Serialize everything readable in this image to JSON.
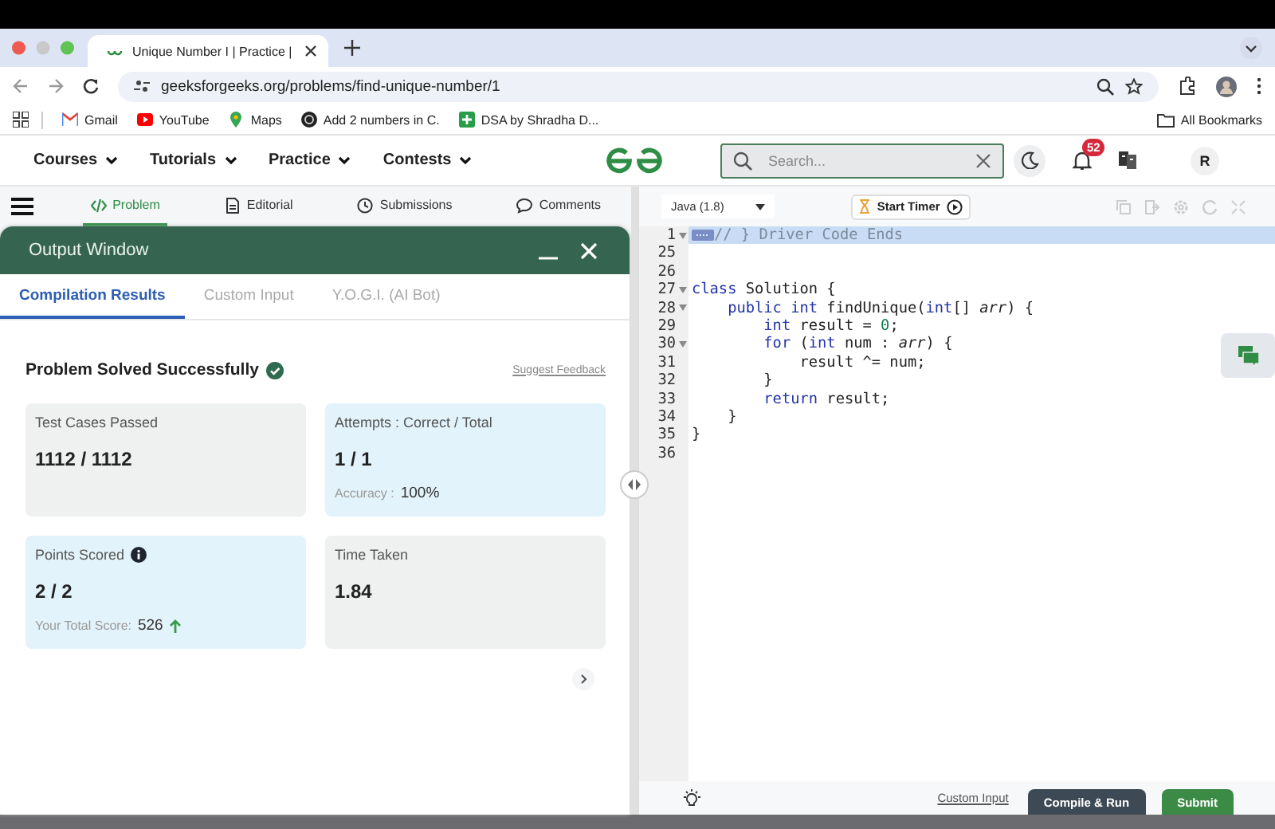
{
  "browser": {
    "tab_title": "Unique Number I | Practice |",
    "url": "geeksforgeeks.org/problems/find-unique-number/1",
    "bookmarks": [
      {
        "kind": "mail",
        "label": "Gmail"
      },
      {
        "kind": "video",
        "label": "YouTube"
      },
      {
        "kind": "pin",
        "label": "Maps"
      },
      {
        "kind": "circle",
        "label": "Add 2 numbers in C."
      },
      {
        "kind": "plus",
        "label": "DSA by Shradha D..."
      }
    ],
    "all_bookmarks": "All Bookmarks"
  },
  "site_nav": {
    "menus": [
      "Courses",
      "Tutorials",
      "Practice",
      "Contests"
    ],
    "search": {
      "placeholder": "Search..."
    },
    "notification_count": "52",
    "avatar": "R"
  },
  "problem_tabs": [
    {
      "kind": "code",
      "label": "Problem",
      "selected": true
    },
    {
      "kind": "doc",
      "label": "Editorial",
      "selected": false
    },
    {
      "kind": "clock",
      "label": "Submissions",
      "selected": false
    },
    {
      "kind": "chat",
      "label": "Comments",
      "selected": false
    }
  ],
  "output_window": {
    "title": "Output Window",
    "tabs": [
      {
        "label": "Compilation Results",
        "selected": true
      },
      {
        "label": "Custom Input",
        "selected": false
      },
      {
        "label": "Y.O.G.I. (AI Bot)",
        "selected": false
      }
    ],
    "status": "Problem Solved Successfully",
    "feedback_link": "Suggest Feedback",
    "cards": [
      {
        "label": "Test Cases Passed",
        "value": "1112 / 1112",
        "highlighted": false,
        "info": false,
        "rising": false
      },
      {
        "label": "Attempts : Correct / Total",
        "value": "1 / 1",
        "note_label": "Accuracy :",
        "note_value": "100%",
        "highlighted": true,
        "info": false,
        "rising": false
      },
      {
        "label": "Points Scored",
        "value": "2 / 2",
        "note_label": "Your Total Score:",
        "note_value": "526",
        "highlighted": true,
        "info": true,
        "rising": true
      },
      {
        "label": "Time Taken",
        "value": "1.84",
        "highlighted": false,
        "info": false,
        "rising": false
      }
    ]
  },
  "editor": {
    "language": "Java (1.8)",
    "timer": "Start Timer",
    "lines": [
      {
        "number": "1",
        "fold": true,
        "highlighted": true,
        "tokens": [
          {
            "kind": "comment",
            "text": "// } Driver Code Ends"
          }
        ]
      },
      {
        "number": "25",
        "fold": false,
        "highlighted": false
      },
      {
        "number": "26",
        "fold": false,
        "highlighted": false
      },
      {
        "number": "27",
        "fold": true,
        "highlighted": false,
        "tokens": [
          {
            "kind": "keyword",
            "text": "class"
          },
          {
            "kind": "plain",
            "text": " Solution {"
          }
        ]
      },
      {
        "number": "28",
        "fold": true,
        "highlighted": false,
        "tokens": [
          {
            "kind": "keyword",
            "text": "    public"
          },
          {
            "kind": "keyword",
            "text": " int"
          },
          {
            "kind": "plain",
            "text": " findUnique("
          },
          {
            "kind": "keyword",
            "text": "int"
          },
          {
            "kind": "plain",
            "text": "[] "
          },
          {
            "kind": "param",
            "text": "arr"
          },
          {
            "kind": "plain",
            "text": ") {"
          }
        ]
      },
      {
        "number": "29",
        "fold": false,
        "highlighted": false,
        "tokens": [
          {
            "kind": "keyword",
            "text": "        int"
          },
          {
            "kind": "plain",
            "text": " result = "
          },
          {
            "kind": "number",
            "text": "0"
          },
          {
            "kind": "plain",
            "text": ";"
          }
        ]
      },
      {
        "number": "30",
        "fold": true,
        "highlighted": false,
        "tokens": [
          {
            "kind": "keyword",
            "text": "        for"
          },
          {
            "kind": "plain",
            "text": " ("
          },
          {
            "kind": "keyword",
            "text": "int"
          },
          {
            "kind": "plain",
            "text": " num : "
          },
          {
            "kind": "param",
            "text": "arr"
          },
          {
            "kind": "plain",
            "text": ") {"
          }
        ]
      },
      {
        "number": "31",
        "fold": false,
        "highlighted": false,
        "tokens": [
          {
            "kind": "plain",
            "text": "            result ^= num;"
          }
        ]
      },
      {
        "number": "32",
        "fold": false,
        "highlighted": false,
        "tokens": [
          {
            "kind": "plain",
            "text": "        }"
          }
        ]
      },
      {
        "number": "33",
        "fold": false,
        "highlighted": false,
        "tokens": [
          {
            "kind": "keyword",
            "text": "        return"
          },
          {
            "kind": "plain",
            "text": " result;"
          }
        ]
      },
      {
        "number": "34",
        "fold": false,
        "highlighted": false,
        "tokens": [
          {
            "kind": "plain",
            "text": "    }"
          }
        ]
      },
      {
        "number": "35",
        "fold": false,
        "highlighted": false,
        "tokens": [
          {
            "kind": "plain",
            "text": "}"
          }
        ]
      },
      {
        "number": "36",
        "fold": false,
        "highlighted": false
      }
    ],
    "custom_input": "Custom Input",
    "buttons": [
      {
        "kind": "dark",
        "label": "Compile & Run"
      },
      {
        "kind": "primary",
        "label": "Submit"
      }
    ]
  }
}
